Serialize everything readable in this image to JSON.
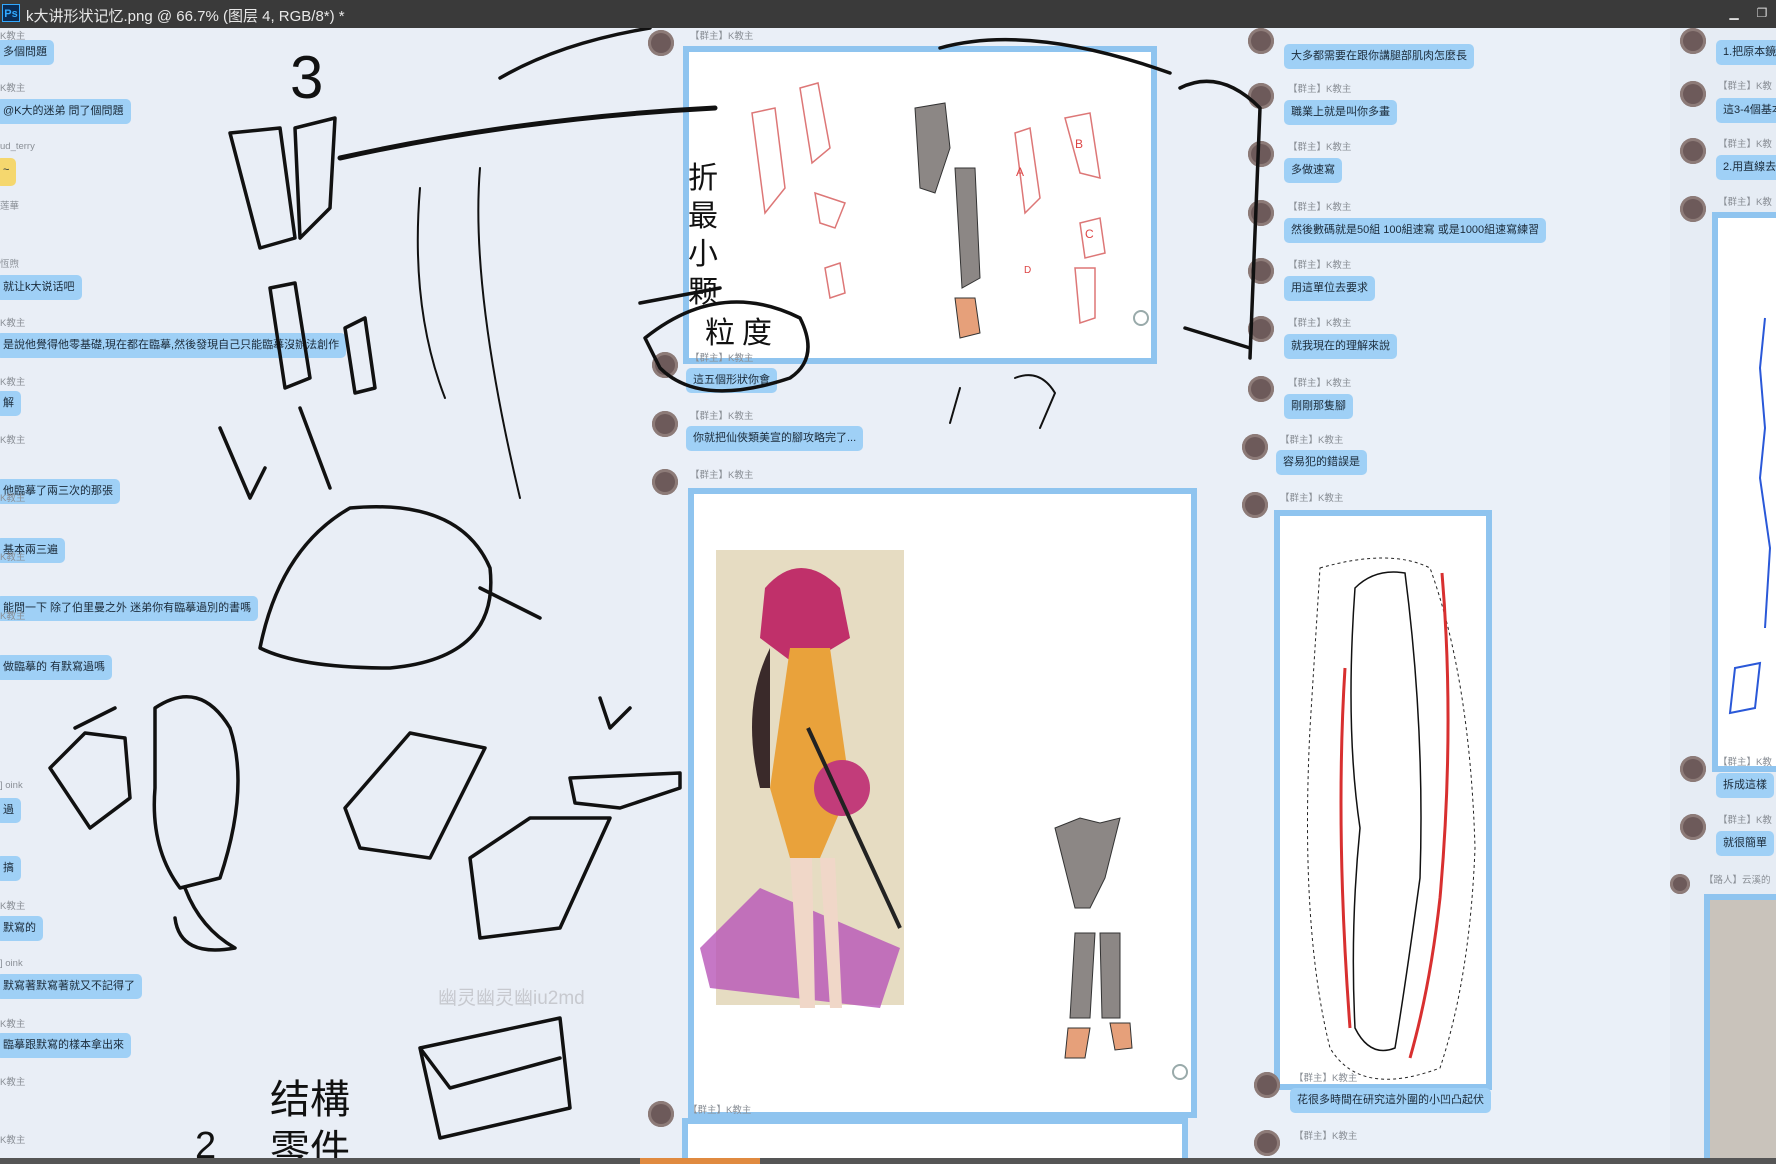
{
  "window": {
    "app_icon": "Ps",
    "title": "k大讲形状记忆.png @ 66.7% (图层 4, RGB/8*) *"
  },
  "colors": {
    "bubble": "#9fd0f6",
    "frame": "#8fc4ef",
    "ink": "#111111",
    "red_line": "#d83030"
  },
  "col1": {
    "names": [
      "K教主",
      "ud_terry",
      "莲華",
      "恆煦",
      "K教主",
      "K教主",
      "K教主",
      "K教主",
      "K教主",
      "K教主",
      "] oink",
      "K教主",
      "] oink",
      "K教主",
      "K教主",
      "K教主"
    ],
    "messages": [
      "多個問題",
      "@K大的迷弟 問了個問題",
      "~",
      "",
      "就让k大说话吧",
      "是說他覺得他零基礎,現在都在臨摹,然後發現自己只能臨摹沒辦法創作",
      "解",
      "他臨摹了兩三次的那張",
      "基本兩三遍",
      "能問一下 除了伯里曼之外 迷弟你有臨摹過別的書嗎",
      "做臨摹的 有默寫過嗎",
      "過",
      "搞",
      "默寫的",
      "默寫著默寫著就又不記得了",
      "臨摹跟默寫的樣本拿出來"
    ]
  },
  "col2": {
    "names": [
      "【群主】K教主",
      "【群主】K教主",
      "【群主】K教主",
      "【群主】K教主",
      "【群主】K教主"
    ],
    "messages": [
      "這五個形狀你會",
      "你就把仙俠類美宣的腳攻略完了..."
    ],
    "watermark": "幽灵幽灵幽iu2md"
  },
  "col3": {
    "names": [
      "【群主】K教主",
      "【群主】K教主",
      "【群主】K教主",
      "【群主】K教主",
      "【群主】K教主",
      "【群主】K教主",
      "【群主】K教主",
      "【群主】K教主",
      "【群主】K教主",
      "【群主】K教主"
    ],
    "messages": [
      "大多都需要在跟你講腿部肌肉怎麼長",
      "職業上就是叫你多畫",
      "多做速寫",
      "然後數碼就是50組 100組速寫 或是1000組速寫練習",
      "用這單位去要求",
      "就我現在的理解來說",
      "剛剛那隻腳",
      "容易犯的錯誤是",
      "花很多時間在研究這外圍的小凹凸起伏"
    ]
  },
  "col4": {
    "names": [
      "【群主】K教",
      "【群主】K教",
      "【群主】K教",
      "【群主】K教",
      "【群主】K教",
      "【群主】K教",
      "【路人】云溪的"
    ],
    "messages": [
      "1.把原本鏡",
      "這3-4個基本",
      "2.用直線去",
      "拆成這樣",
      "就很簡單"
    ]
  },
  "sketch_labels": {
    "number_three": "3",
    "vertical_text_1": "折",
    "vertical_text_2": "最",
    "vertical_text_3": "小",
    "vertical_text_4": "颗",
    "vertical_text_5": "粒",
    "vertical_text_6": "度",
    "bottom_text_1": "结構",
    "bottom_text_2": "零件",
    "bottom_number": "2",
    "label_a": "A",
    "label_b": "B",
    "label_c": "C",
    "label_d": "D"
  }
}
